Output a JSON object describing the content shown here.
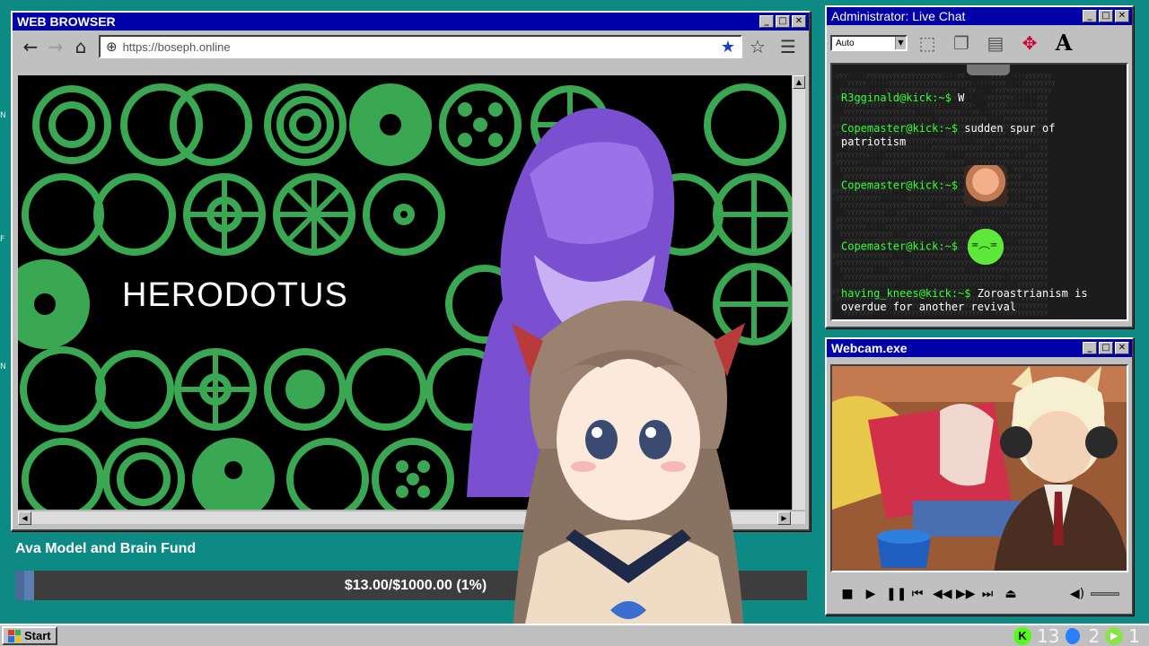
{
  "browser": {
    "title": "WEB BROWSER",
    "url": "https://boseph.online",
    "slide_title": "HERODOTUS"
  },
  "chat": {
    "title": "Administrator: Live Chat",
    "font_select": "Auto",
    "messages": [
      {
        "user": "R3gginald@kick:~$",
        "text": "W",
        "emote": ""
      },
      {
        "user": "Copemaster@kick:~$",
        "text": "sudden spur of patriotism",
        "emote": ""
      },
      {
        "user": "Copemaster@kick:~$",
        "text": "",
        "emote": "face-emote"
      },
      {
        "user": "Copemaster@kick:~$",
        "text": "",
        "emote": "sick-emote"
      },
      {
        "user": "having_knees@kick:~$",
        "text": "Zoroastrianism is overdue for another revival",
        "emote": ""
      }
    ]
  },
  "webcam": {
    "title": "Webcam.exe"
  },
  "fund": {
    "label": "Ava Model and Brain Fund",
    "amount_text": "$13.00/$1000.00 (1%)",
    "progress_percent": 1.3
  },
  "taskbar": {
    "start_label": "Start",
    "tray": {
      "kick_count": "13",
      "moon_count": "2",
      "play_count": "1"
    }
  },
  "colors": {
    "desktop": "#0d8a84",
    "titlebar": "#0000a8",
    "chat_user": "#33ff33",
    "slide_green": "#3aa853"
  },
  "icons": {
    "back": "arrow-left-icon",
    "forward": "arrow-right-icon",
    "home": "home-icon",
    "globe": "globe-icon",
    "bookmark": "star-filled-icon",
    "favorites": "star-outline-icon",
    "menu": "hamburger-menu-icon"
  }
}
